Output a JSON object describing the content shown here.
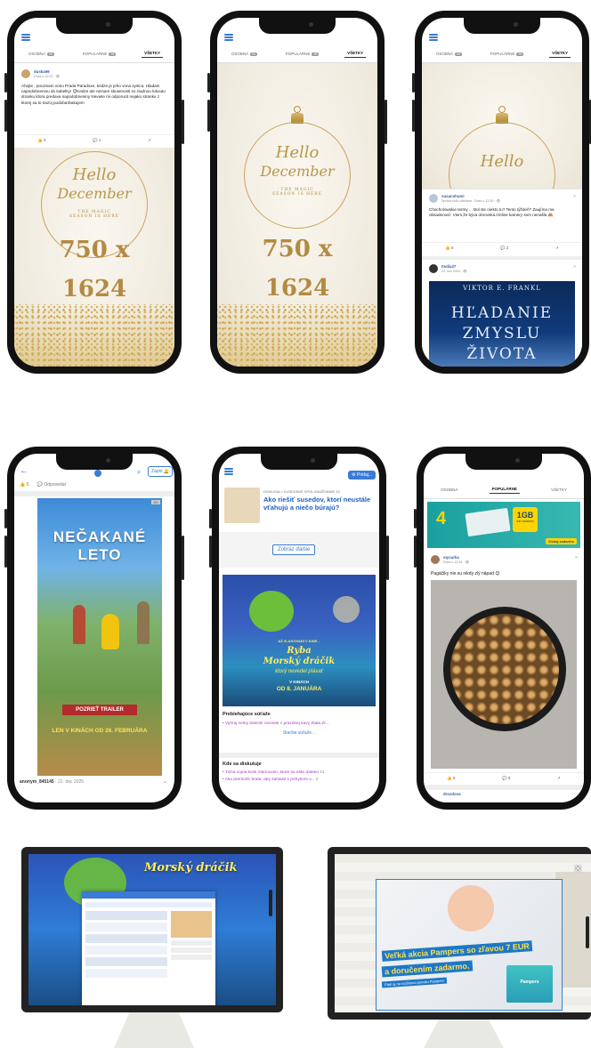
{
  "tabs": {
    "unread": "OSOBNÁ",
    "unread_count": "99",
    "popular": "POPULÁRNE",
    "popular_count": "99",
    "all": "VŠETKY"
  },
  "tabs2": {
    "personal": "OSOBNÁ",
    "popular": "POPULÁRNE",
    "all": "VŠETKY"
  },
  "phone1": {
    "post": {
      "user": "duska99",
      "meta": "Dnes o 12:02 · 👁",
      "text": "Ahojte , pouzivam vonu Prada Paradoxe, kedze je jeho vona sysica. Hladam napodobneninu do kabelky! 😊Kedze ale nemam skusenosti so ziadnou lukoutu stranku ktora predava napodobneniny Neviete mi odporucit nejaku stranku z ktorej sa to nazoj podoba!Dakujem",
      "likes": "0",
      "comments": "1"
    },
    "poster": {
      "hello": "Hello",
      "december": "December",
      "tagline1": "THE MAGIC",
      "tagline2": "SEASON IS HERE",
      "size1": "750 x",
      "size2": "1624"
    }
  },
  "phone2": {
    "poster": {
      "hello": "Hello",
      "december": "December",
      "tagline1": "THE MAGIC",
      "tagline2": "SEASON IS HERE",
      "size1": "750 x",
      "size2": "1624"
    }
  },
  "phone3": {
    "post1": {
      "user": "susanshumi",
      "meta": "Správa bola zdieľaná · Dnes o 12:30 · 👁",
      "text": "Chocholowskie termy ... Bol ste niekto tu? Tento týždeň? Zaujíma ma obsadenosť. Viem,že bývа obrovská.Online kamery som nenašla 🙈",
      "likes": "0",
      "comments": "2"
    },
    "post2": {
      "user": "Itsdia27",
      "meta": "22. nov 2016 · 👁"
    },
    "book": {
      "author": "VIKTOR E. FRANKL",
      "title1": "HĽADANIE",
      "title2": "ZMYSLU",
      "title3": "ŽIVOTA"
    }
  },
  "phone4": {
    "top": {
      "likes": "0",
      "reply": "Odpovedať",
      "join": "Zapni"
    },
    "ad": {
      "title1": "NEČAKANÉ",
      "title2": "LETO",
      "trailer": "POZRIEŤ TRAILER",
      "cinema": "LEN V KINÁCH OD 26. FEBRUÁRA",
      "badge": "AD"
    },
    "footer": {
      "user": "anonym_845145",
      "date": "21. dec 2025"
    }
  },
  "phone5": {
    "add": "Pridaj...",
    "discussion": {
      "crumb": "DISKUSIA » SUSEDSKÉ SPOLUNAŽÍVANIE",
      "crumb_count": "15",
      "title": "Ako riešiť susedov, ktorí neustále vťahujú a niečo búrajú?"
    },
    "show_more": "Zobraz ďalšie",
    "movie": {
      "overline": "AŽ ZLAKOVANÍ V KINE...",
      "title1": "Ryba",
      "title2": "Morský dráčik",
      "subtitle": "ktorý nevedel plávať",
      "date1": "V KINÁCH",
      "date2": "OD 8. JANUÁRA"
    },
    "contests": {
      "heading": "Prebiehajúce súťaže",
      "item": "Vyhraj veľký balíček novinek z prázdnej kávy Zlatá Zr...",
      "more": "Staršie súťaže..."
    },
    "discuss": {
      "heading": "Kde sa diskutuje",
      "item1": "Tichá vojna kvôli Vianociam, ktoré sú ešte ďaleko",
      "item1_count": "41",
      "item2": "Ako premôžiť brata, aby súhlasil s pohybom v...",
      "item2_count": "2"
    }
  },
  "phone6": {
    "banner": {
      "data": "1GB",
      "data_sub": "dát zadarmo",
      "cta": "Získaj zadarmo"
    },
    "post": {
      "user": "mycarka",
      "meta": "Dnes o 12:33 · 👁",
      "text": "Pagáčiky nie su nikdy zlý nápad 😊",
      "likes": "6",
      "comments": "0"
    },
    "next_user": "drozdova"
  },
  "monitor1": {
    "movie_title": "Morský dráčik"
  },
  "monitor2": {
    "headline1": "Veľká akcia Pampers so zľavou 7 EUR",
    "headline2": "a doručením zadarmo.",
    "sub": "Platí aj na rozšírenú ponuku Pampers",
    "close": "✕",
    "brand": "Pampers"
  }
}
